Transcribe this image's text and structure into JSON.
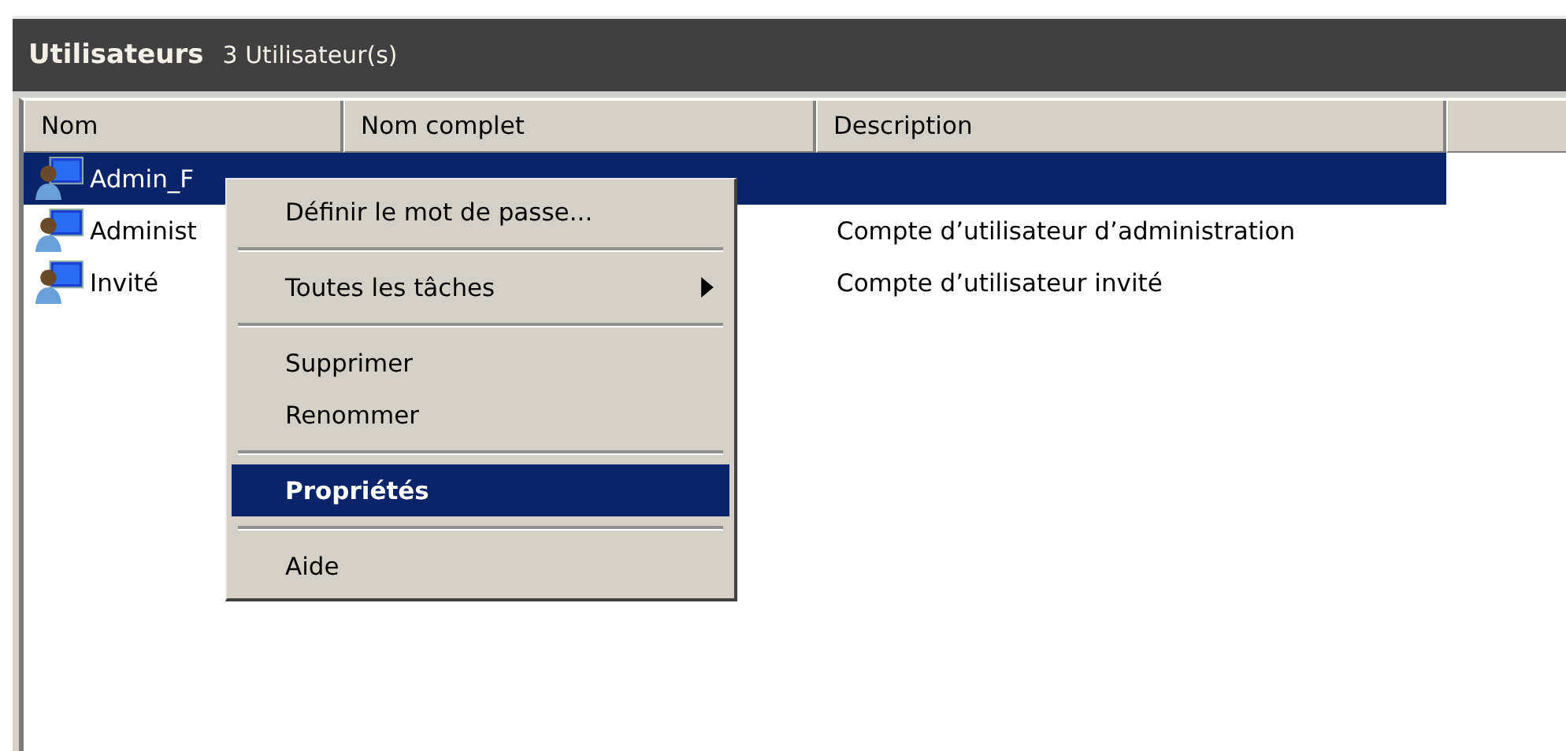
{
  "panel": {
    "title": "Utilisateurs",
    "count": "3 Utilisateur(s)"
  },
  "table": {
    "columns": [
      "Nom",
      "Nom complet",
      "Description"
    ],
    "rows": [
      {
        "name": "Admin_F",
        "full_name": "",
        "description": "",
        "selected": true
      },
      {
        "name": "Administ",
        "full_name": "",
        "description": "Compte d’utilisateur d’administration",
        "selected": false
      },
      {
        "name": "Invité",
        "full_name": "",
        "description": "Compte d’utilisateur invité",
        "selected": false
      }
    ]
  },
  "context_menu": {
    "items": [
      {
        "kind": "item",
        "label": "Définir le mot de passe...",
        "submenu": false,
        "selected": false
      },
      {
        "kind": "separator"
      },
      {
        "kind": "item",
        "label": "Toutes les tâches",
        "submenu": true,
        "selected": false
      },
      {
        "kind": "separator"
      },
      {
        "kind": "item",
        "label": "Supprimer",
        "submenu": false,
        "selected": false
      },
      {
        "kind": "item",
        "label": "Renommer",
        "submenu": false,
        "selected": false
      },
      {
        "kind": "separator"
      },
      {
        "kind": "item",
        "label": "Propriétés",
        "submenu": false,
        "selected": true
      },
      {
        "kind": "separator"
      },
      {
        "kind": "item",
        "label": "Aide",
        "submenu": false,
        "selected": false
      }
    ]
  }
}
